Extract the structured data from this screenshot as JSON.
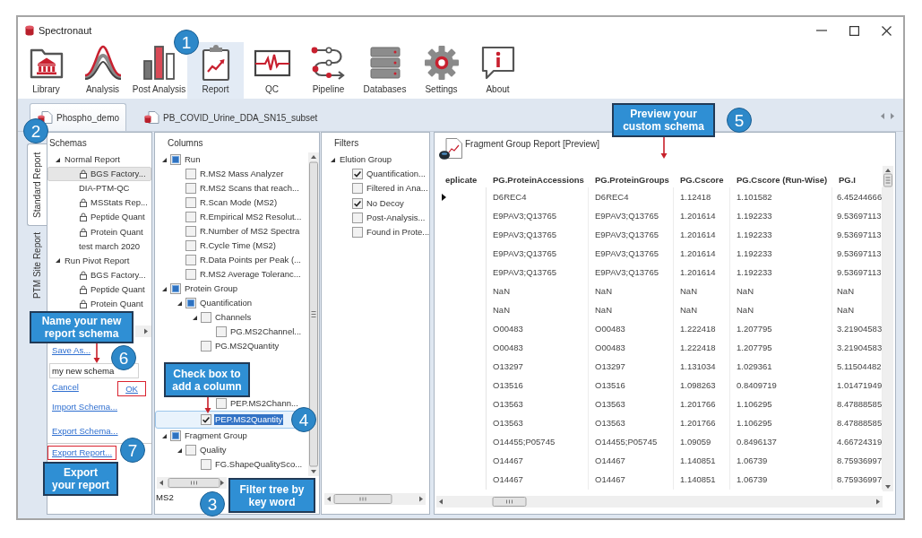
{
  "window": {
    "title": "Spectronaut"
  },
  "toolbar": [
    {
      "kind": "library",
      "label": "Library",
      "selected": false
    },
    {
      "kind": "analysis",
      "label": "Analysis",
      "selected": false
    },
    {
      "kind": "post_analysis",
      "label": "Post Analysis",
      "selected": false
    },
    {
      "kind": "report",
      "label": "Report",
      "selected": true
    },
    {
      "kind": "qc",
      "label": "QC",
      "selected": false
    },
    {
      "kind": "pipeline",
      "label": "Pipeline",
      "selected": false
    },
    {
      "kind": "databases",
      "label": "Databases",
      "selected": false
    },
    {
      "kind": "settings",
      "label": "Settings",
      "selected": false
    },
    {
      "kind": "about",
      "label": "About",
      "selected": false
    }
  ],
  "document_tabs": [
    {
      "label": "Phospho_demo",
      "selected": true
    },
    {
      "label": "PB_COVID_Urine_DDA_SN15_subset",
      "selected": false
    }
  ],
  "report_tabs": [
    {
      "label": "Standard Report",
      "selected": true
    },
    {
      "label": "PTM Site Report",
      "selected": false
    }
  ],
  "schemas": {
    "title": "Schemas",
    "tree": [
      {
        "label": "Normal Report",
        "expanded": true,
        "selected": false,
        "children": [
          {
            "label": "BGS Factory...",
            "locked": true,
            "selected": true
          },
          {
            "label": "DIA-PTM-QC",
            "locked": false,
            "selected": false
          },
          {
            "label": "MSStats Rep...",
            "locked": true,
            "selected": false
          },
          {
            "label": "Peptide Quant",
            "locked": true,
            "selected": false
          },
          {
            "label": "Protein Quant",
            "locked": true,
            "selected": false
          },
          {
            "label": "test march 2020",
            "locked": false,
            "selected": false
          }
        ]
      },
      {
        "label": "Run Pivot Report",
        "expanded": true,
        "selected": false,
        "children": [
          {
            "label": "BGS Factory...",
            "locked": true,
            "selected": false
          },
          {
            "label": "Peptide Quant",
            "locked": true,
            "selected": false
          },
          {
            "label": "Protein Quant",
            "locked": true,
            "selected": false
          }
        ]
      }
    ],
    "save_as_link": {
      "label": "Save As...",
      "highlighted": false
    },
    "name_field": {
      "value": "my new schema"
    },
    "confirm_links": [
      {
        "label": "Cancel",
        "highlighted": false
      },
      {
        "label": "OK",
        "highlighted": true
      }
    ],
    "action_links": [
      {
        "label": "Import Schema...",
        "highlighted": false
      },
      {
        "label": "Export Schema...",
        "highlighted": false
      },
      {
        "label": "Export Report...",
        "highlighted": true
      }
    ]
  },
  "columns": {
    "title": "Columns",
    "tree": [
      {
        "label": "Run",
        "expanded": true,
        "checked": false,
        "partial": true,
        "selected": false,
        "children": [
          {
            "label": "R.MS2 Mass Analyzer",
            "checked": false,
            "partial": false,
            "selected": false
          },
          {
            "label": "R.MS2 Scans that reach...",
            "checked": false,
            "partial": false,
            "selected": false
          },
          {
            "label": "R.Scan Mode (MS2)",
            "checked": false,
            "partial": false,
            "selected": false
          },
          {
            "label": "R.Empirical MS2 Resolut...",
            "checked": false,
            "partial": false,
            "selected": false
          },
          {
            "label": "R.Number of MS2 Spectra",
            "checked": false,
            "partial": false,
            "selected": false
          },
          {
            "label": "R.Cycle Time (MS2)",
            "checked": false,
            "partial": false,
            "selected": false
          },
          {
            "label": "R.Data Points per Peak (...",
            "checked": false,
            "partial": false,
            "selected": false
          },
          {
            "label": "R.MS2 Average Toleranc...",
            "checked": false,
            "partial": false,
            "selected": false
          }
        ]
      },
      {
        "label": "Protein Group",
        "expanded": true,
        "checked": false,
        "partial": true,
        "selected": false,
        "children": [
          {
            "label": "Quantification",
            "expanded": true,
            "checked": false,
            "partial": true,
            "selected": false,
            "children": [
              {
                "label": "Channels",
                "expanded": true,
                "checked": false,
                "partial": false,
                "selected": false,
                "children": [
                  {
                    "label": "PG.MS2Channel...",
                    "checked": false,
                    "partial": false,
                    "selected": false
                  }
                ]
              },
              {
                "label": "PG.MS2Quantity",
                "checked": false,
                "partial": false,
                "selected": false
              }
            ]
          }
        ]
      },
      {
        "children": [
          {
            "children": [
              {
                "children": [
                  {
                    "label": "PEP.MS2Chann...",
                    "checked": false,
                    "partial": false,
                    "selected": false
                  }
                ]
              },
              {
                "label": "PEP.MS2Quantity",
                "checked": true,
                "partial": false,
                "selected": true
              }
            ]
          }
        ]
      },
      {
        "label": "Fragment Group",
        "expanded": true,
        "checked": false,
        "partial": true,
        "selected": false,
        "children": [
          {
            "label": "Quality",
            "expanded": true,
            "checked": false,
            "partial": false,
            "selected": false,
            "children": [
              {
                "label": "FG.ShapeQualitySco...",
                "checked": false,
                "partial": false,
                "selected": false
              }
            ]
          }
        ]
      }
    ],
    "filter_field": {
      "value": "MS2"
    }
  },
  "filters": {
    "title": "Filters",
    "tree": [
      {
        "label": "Elution Group",
        "expanded": true,
        "children": [
          {
            "label": "Quantification...",
            "checked": true
          },
          {
            "label": "Filtered in Ana...",
            "checked": false
          },
          {
            "label": "No Decoy",
            "checked": true
          },
          {
            "label": "Post-Analysis...",
            "checked": false
          },
          {
            "label": "Found in Prote...",
            "checked": false
          }
        ]
      }
    ]
  },
  "preview": {
    "title": "Fragment Group Report [Preview]",
    "table": {
      "columns": [
        "eplicate",
        "PG.ProteinAccessions",
        "PG.ProteinGroups",
        "PG.Cscore",
        "PG.Cscore (Run-Wise)",
        "PG.I"
      ],
      "rows": [
        {
          "current": true,
          "cells": [
            "",
            "D6REC4",
            "D6REC4",
            "1.12418",
            "1.101582",
            "6.45244666"
          ]
        },
        {
          "current": false,
          "cells": [
            "",
            "E9PAV3;Q13765",
            "E9PAV3;Q13765",
            "1.201614",
            "1.192233",
            "9.53697113"
          ]
        },
        {
          "current": false,
          "cells": [
            "",
            "E9PAV3;Q13765",
            "E9PAV3;Q13765",
            "1.201614",
            "1.192233",
            "9.53697113"
          ]
        },
        {
          "current": false,
          "cells": [
            "",
            "E9PAV3;Q13765",
            "E9PAV3;Q13765",
            "1.201614",
            "1.192233",
            "9.53697113"
          ]
        },
        {
          "current": false,
          "cells": [
            "",
            "E9PAV3;Q13765",
            "E9PAV3;Q13765",
            "1.201614",
            "1.192233",
            "9.53697113"
          ]
        },
        {
          "current": false,
          "cells": [
            "",
            "NaN",
            "NaN",
            "NaN",
            "NaN",
            "NaN"
          ]
        },
        {
          "current": false,
          "cells": [
            "",
            "NaN",
            "NaN",
            "NaN",
            "NaN",
            "NaN"
          ]
        },
        {
          "current": false,
          "cells": [
            "",
            "O00483",
            "O00483",
            "1.222418",
            "1.207795",
            "3.21904583"
          ]
        },
        {
          "current": false,
          "cells": [
            "",
            "O00483",
            "O00483",
            "1.222418",
            "1.207795",
            "3.21904583"
          ]
        },
        {
          "current": false,
          "cells": [
            "",
            "O13297",
            "O13297",
            "1.131034",
            "1.029361",
            "5.11504482"
          ]
        },
        {
          "current": false,
          "cells": [
            "",
            "O13516",
            "O13516",
            "1.098263",
            "0.8409719",
            "1.01471949"
          ]
        },
        {
          "current": false,
          "cells": [
            "",
            "O13563",
            "O13563",
            "1.201766",
            "1.106295",
            "8.47888585"
          ]
        },
        {
          "current": false,
          "cells": [
            "",
            "O13563",
            "O13563",
            "1.201766",
            "1.106295",
            "8.47888585"
          ]
        },
        {
          "current": false,
          "cells": [
            "",
            "O14455;P05745",
            "O14455;P05745",
            "1.09059",
            "0.8496137",
            "4.66724319"
          ]
        },
        {
          "current": false,
          "cells": [
            "",
            "O14467",
            "O14467",
            "1.140851",
            "1.06739",
            "8.75936997"
          ]
        },
        {
          "current": false,
          "cells": [
            "",
            "O14467",
            "O14467",
            "1.140851",
            "1.06739",
            "8.75936997"
          ]
        }
      ]
    }
  },
  "annotations": {
    "step_markers": [
      "1",
      "2",
      "3",
      "4",
      "5",
      "6",
      "7"
    ],
    "callouts": [
      "Preview your custom schema",
      "Name your new report schema",
      "Check box to add a column",
      "Export your report",
      "Filter tree by key word"
    ]
  }
}
